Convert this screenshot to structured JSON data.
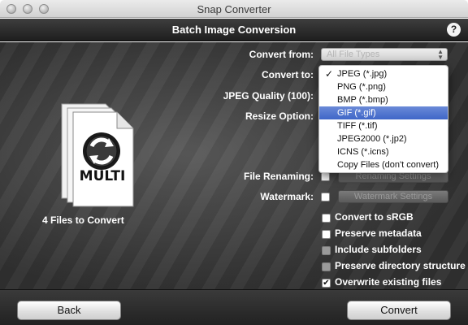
{
  "window": {
    "title": "Snap Converter"
  },
  "header": {
    "title": "Batch Image Conversion",
    "help": "?"
  },
  "form": {
    "convert_from": {
      "label": "Convert from:",
      "value": "All File Types"
    },
    "convert_to": {
      "label": "Convert to:"
    },
    "jpeg_quality": {
      "label": "JPEG Quality (100):",
      "value": 100
    },
    "resize_option": {
      "label": "Resize Option:"
    },
    "file_renaming": {
      "label": "File Renaming:",
      "button": "Renaming Settings"
    },
    "watermark": {
      "label": "Watermark:",
      "button": "Watermark Settings"
    }
  },
  "file_icon": {
    "badge": "MULTI"
  },
  "files_label": "4 Files to Convert",
  "format_menu": {
    "items": [
      {
        "label": "JPEG (*.jpg)",
        "checked": true
      },
      {
        "label": "PNG (*.png)"
      },
      {
        "label": "BMP (*.bmp)"
      },
      {
        "label": "GIF (*.gif)",
        "highlighted": true
      },
      {
        "label": "TIFF (*.tif)"
      },
      {
        "label": "JPEG2000 (*.jp2)"
      },
      {
        "label": "ICNS (*.icns)"
      },
      {
        "label": "Copy Files (don't convert)"
      }
    ]
  },
  "options": [
    {
      "label": "Convert to sRGB",
      "checked": false,
      "enabled": true
    },
    {
      "label": "Preserve metadata",
      "checked": false,
      "enabled": true
    },
    {
      "label": "Include subfolders",
      "checked": false,
      "enabled": false
    },
    {
      "label": "Preserve directory structure",
      "checked": false,
      "enabled": false
    },
    {
      "label": "Overwrite existing files",
      "checked": true,
      "enabled": true
    }
  ],
  "footer": {
    "back": "Back",
    "convert": "Convert"
  },
  "colors": {
    "menu_highlight": "#3f66c8",
    "header_bg": "#2a2a2a"
  }
}
